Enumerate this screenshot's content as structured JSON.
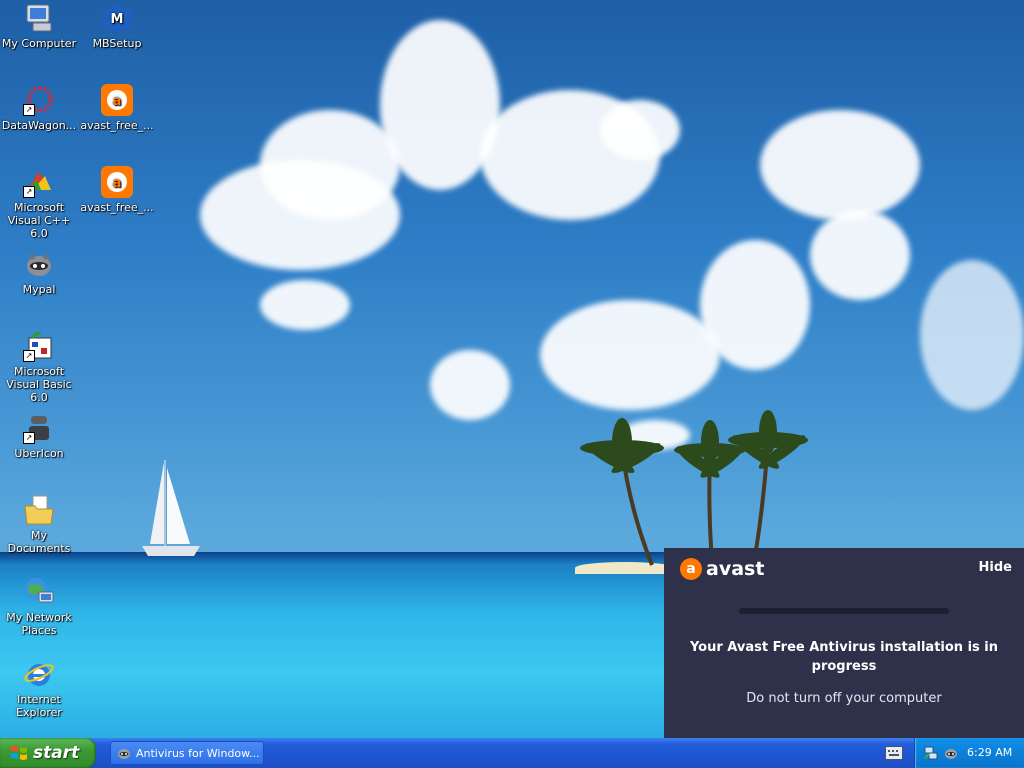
{
  "desktop": {
    "icons": [
      {
        "label": "My Computer",
        "icon": "my-computer-icon"
      },
      {
        "label": "MBSetup",
        "icon": "mbsetup-icon"
      },
      {
        "label": "DataWagon...",
        "icon": "datawagon-icon"
      },
      {
        "label": "avast_free_...",
        "icon": "avast-installer-icon"
      },
      {
        "label": "Microsoft Visual C++ 6.0",
        "icon": "visual-cpp-icon"
      },
      {
        "label": "avast_free_...",
        "icon": "avast-installer-icon"
      },
      {
        "label": "Mypal",
        "icon": "mypal-icon"
      },
      {
        "label": "Microsoft Visual Basic 6.0",
        "icon": "visual-basic-icon"
      },
      {
        "label": "UberIcon",
        "icon": "ubericon-icon"
      },
      {
        "label": "My Documents",
        "icon": "my-documents-icon"
      },
      {
        "label": "My Network Places",
        "icon": "network-places-icon"
      },
      {
        "label": "Internet Explorer",
        "icon": "internet-explorer-icon"
      }
    ]
  },
  "avast_popup": {
    "logo_mark": "a",
    "logo_text": "avast",
    "hide_label": "Hide",
    "progress": 0,
    "message": "Your Avast Free Antivirus installation is in progress",
    "submessage": "Do not turn off your computer",
    "brand_color": "#ff7800",
    "background_color": "#2e3149"
  },
  "taskbar": {
    "start_label": "start",
    "task_button_label": "Antivirus for Window...",
    "clock": "6:29 AM"
  }
}
